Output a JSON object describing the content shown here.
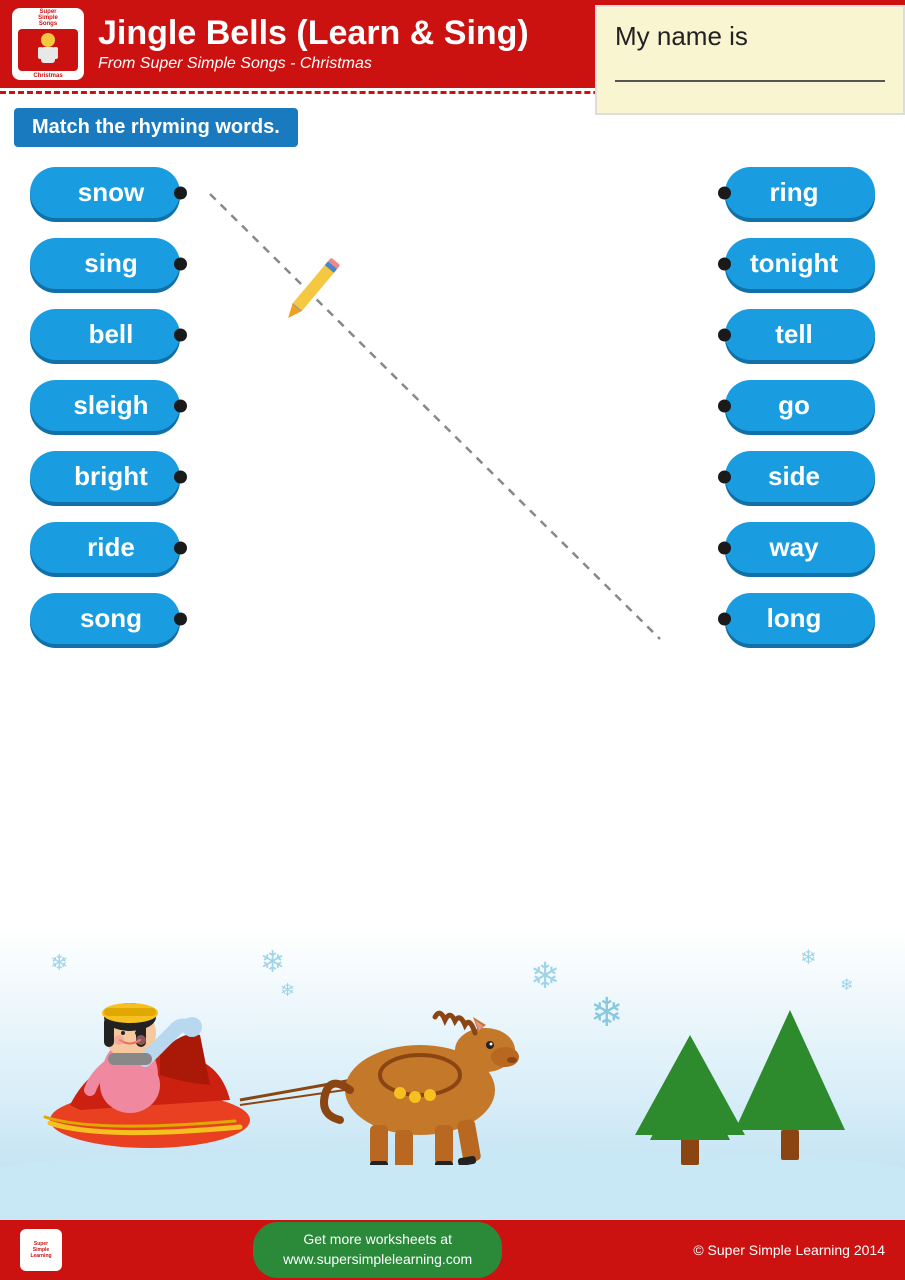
{
  "header": {
    "title": "Jingle Bells (Learn & Sing)",
    "subtitle": "From Super Simple Songs - Christmas",
    "logo_lines": [
      "Super",
      "Simple",
      "Songs",
      "Christmas"
    ]
  },
  "name_section": {
    "label": "My name is"
  },
  "instruction": {
    "text": "Match the rhyming words."
  },
  "left_words": [
    {
      "word": "snow",
      "id": "snow"
    },
    {
      "word": "sing",
      "id": "sing"
    },
    {
      "word": "bell",
      "id": "bell"
    },
    {
      "word": "sleigh",
      "id": "sleigh"
    },
    {
      "word": "bright",
      "id": "bright"
    },
    {
      "word": "ride",
      "id": "ride"
    },
    {
      "word": "song",
      "id": "song"
    }
  ],
  "right_words": [
    {
      "word": "ring",
      "id": "ring"
    },
    {
      "word": "tonight",
      "id": "tonight"
    },
    {
      "word": "tell",
      "id": "tell"
    },
    {
      "word": "go",
      "id": "go"
    },
    {
      "word": "side",
      "id": "side"
    },
    {
      "word": "way",
      "id": "way"
    },
    {
      "word": "long",
      "id": "long"
    }
  ],
  "footer": {
    "center_line1": "Get more worksheets at",
    "center_line2": "www.supersimplelearning.com",
    "copyright": "© Super Simple Learning 2014"
  },
  "colors": {
    "red": "#cc1111",
    "blue": "#1a9de0",
    "dark_blue": "#1a7abf",
    "green": "#2a8a3a"
  }
}
